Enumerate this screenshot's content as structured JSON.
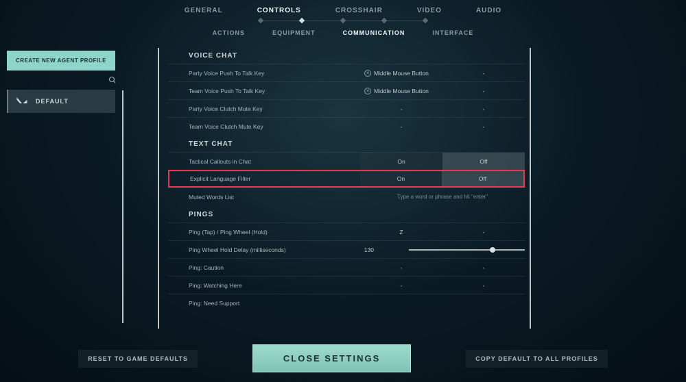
{
  "top_tabs": {
    "general": "GENERAL",
    "controls": "CONTROLS",
    "crosshair": "CROSSHAIR",
    "video": "VIDEO",
    "audio": "AUDIO"
  },
  "sub_tabs": {
    "actions": "ACTIONS",
    "equipment": "EQUIPMENT",
    "communication": "COMMUNICATION",
    "interface": "INTERFACE"
  },
  "sidebar": {
    "create_label": "CREATE NEW AGENT PROFILE",
    "default_label": "DEFAULT"
  },
  "sections": {
    "voice_chat": "VOICE CHAT",
    "text_chat": "TEXT CHAT",
    "pings": "PINGS"
  },
  "voice": {
    "party_ptt": {
      "label": "Party Voice Push To Talk Key",
      "val1": "Middle Mouse Button",
      "val2": "-"
    },
    "team_ptt": {
      "label": "Team Voice Push To Talk Key",
      "val1": "Middle Mouse Button",
      "val2": "-"
    },
    "party_clutch": {
      "label": "Party Voice Clutch Mute Key",
      "val1": "-",
      "val2": "-"
    },
    "team_clutch": {
      "label": "Team Voice Clutch Mute Key",
      "val1": "-",
      "val2": "-"
    }
  },
  "text": {
    "callouts": {
      "label": "Tactical Callouts in Chat",
      "on": "On",
      "off": "Off"
    },
    "filter": {
      "label": "Explicit Language Filter",
      "on": "On",
      "off": "Off"
    },
    "muted": {
      "label": "Muted Words List",
      "placeholder": "Type a word or phrase and hit \"enter\""
    }
  },
  "pings": {
    "ping_wheel": {
      "label": "Ping (Tap) / Ping Wheel (Hold)",
      "val1": "Z",
      "val2": "-"
    },
    "delay": {
      "label": "Ping Wheel Hold Delay (milliseconds)",
      "val": "130"
    },
    "caution": {
      "label": "Ping: Caution",
      "val1": "-",
      "val2": "-"
    },
    "watching": {
      "label": "Ping: Watching Here",
      "val1": "-",
      "val2": "-"
    },
    "need": {
      "label": "Ping: Need Support"
    }
  },
  "footer": {
    "reset": "RESET TO GAME DEFAULTS",
    "close": "CLOSE SETTINGS",
    "copy": "COPY DEFAULT TO ALL PROFILES"
  }
}
